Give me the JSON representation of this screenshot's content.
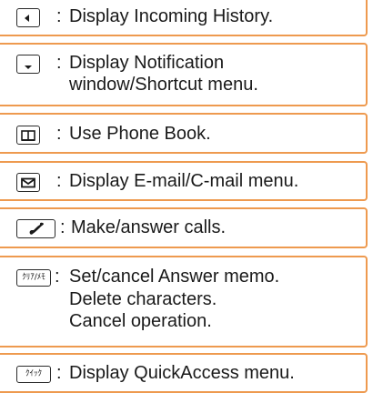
{
  "colors": {
    "border": "#ee9a4f",
    "text": "#1a1a1a",
    "key_border": "#2a2a2a"
  },
  "rows": [
    {
      "key_icon": "left-arrow-key-icon",
      "separator": ":",
      "lines": [
        "Display Incoming History."
      ]
    },
    {
      "key_icon": "down-arrow-key-icon",
      "separator": ":",
      "lines": [
        "Display Notification",
        "window/Shortcut menu."
      ]
    },
    {
      "key_icon": "phonebook-key-icon",
      "separator": ":",
      "lines": [
        "Use Phone Book."
      ]
    },
    {
      "key_icon": "mail-key-icon",
      "separator": ":",
      "lines": [
        "Display E-mail/C-mail menu."
      ]
    },
    {
      "key_icon": "call-key-icon",
      "separator": ":",
      "lines": [
        "Make/answer calls."
      ]
    },
    {
      "key_icon": "clear-memo-key-icon",
      "key_text": "ｸﾘｱ/ﾒﾓ",
      "separator": ":",
      "lines": [
        "Set/cancel Answer memo.",
        "Delete characters.",
        "Cancel operation."
      ]
    },
    {
      "key_icon": "quick-access-key-icon",
      "key_text": "ｸｲｯｸ",
      "separator": ":",
      "lines": [
        "Display QuickAccess menu."
      ]
    }
  ]
}
